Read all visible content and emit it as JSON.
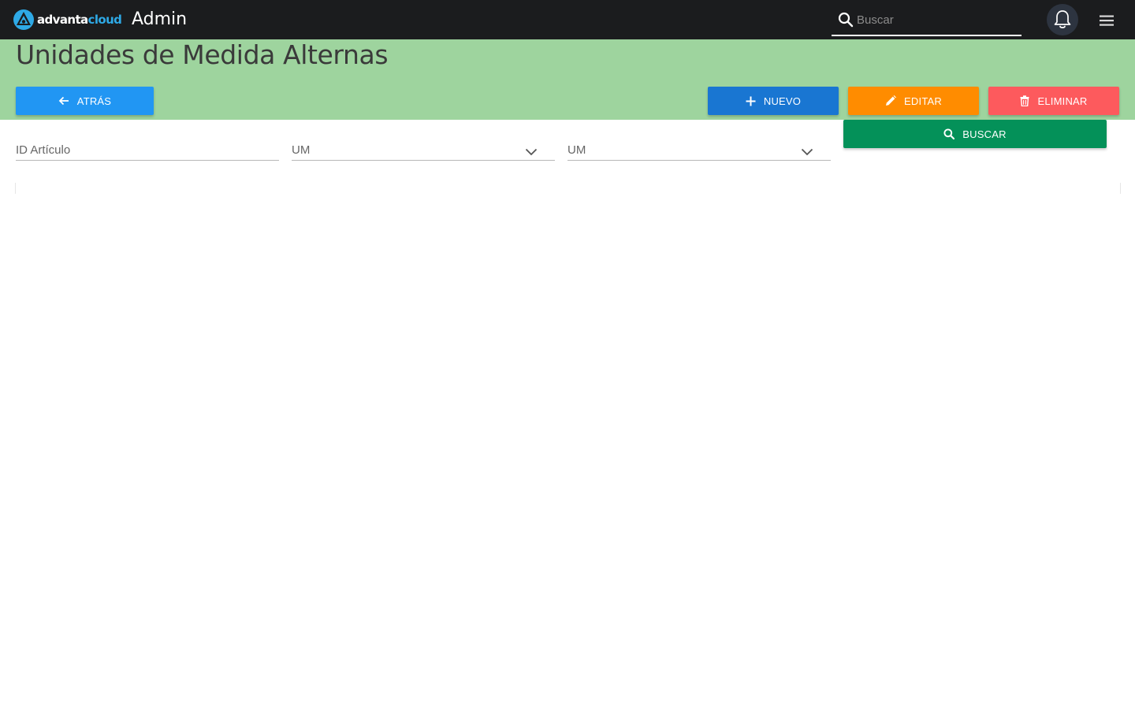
{
  "app": {
    "brand_prefix": "advanta",
    "brand_accent": "cloud",
    "title": "Admin"
  },
  "topbar": {
    "search_placeholder": "Buscar",
    "search_icon": "search-icon",
    "notifications_icon": "bell-icon",
    "menu_icon": "hamburger-menu-icon"
  },
  "page": {
    "title": "Unidades de Medida Alternas"
  },
  "actions": {
    "back": "ATRÁS",
    "new": "NUEVO",
    "edit": "EDITAR",
    "delete": "ELIMINAR",
    "search": "BUSCAR"
  },
  "filters": {
    "id_articulo": {
      "label": "ID Artículo",
      "value": ""
    },
    "um_from": {
      "label": "UM",
      "value": ""
    },
    "um_to": {
      "label": "UM",
      "value": ""
    }
  },
  "colors": {
    "topbar": "#1b1c1e",
    "header": "#9ed49e",
    "back": "#2196f3",
    "new": "#1976d2",
    "edit": "#ff8c00",
    "delete": "#fd5a5d",
    "search": "#049159",
    "brand_accent": "#2ea9e6"
  }
}
